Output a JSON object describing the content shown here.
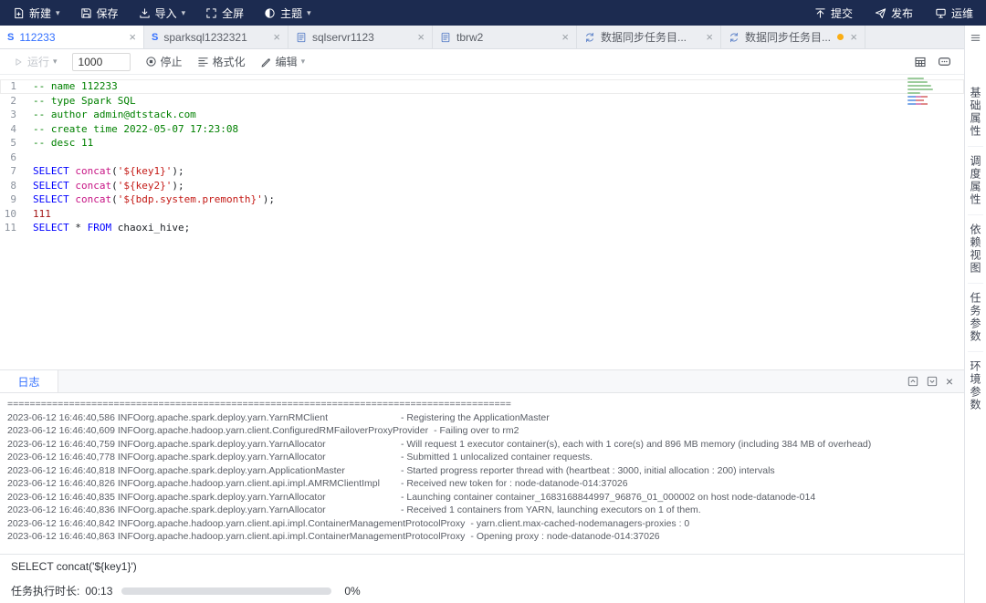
{
  "colors": {
    "topbar-bg": "#1c2b50",
    "accent": "#3370ff",
    "tok-comment": "#008000",
    "tok-keyword": "#0000ff",
    "tok-function": "#c71585",
    "tok-string": "#c41a16",
    "tok-number": "#a31515"
  },
  "topbar": {
    "left": [
      {
        "id": "new",
        "label": "新建",
        "icon": "new",
        "dropdown": true
      },
      {
        "id": "save",
        "label": "保存",
        "icon": "save",
        "dropdown": false
      },
      {
        "id": "import",
        "label": "导入",
        "icon": "import",
        "dropdown": true
      },
      {
        "id": "fullscreen",
        "label": "全屏",
        "icon": "fullscreen",
        "dropdown": false
      },
      {
        "id": "theme",
        "label": "主题",
        "icon": "theme",
        "dropdown": true
      }
    ],
    "right": [
      {
        "id": "submit",
        "label": "提交",
        "icon": "submit",
        "dropdown": false
      },
      {
        "id": "publish",
        "label": "发布",
        "icon": "publish",
        "dropdown": false
      },
      {
        "id": "ops",
        "label": "运维",
        "icon": "ops",
        "dropdown": false
      }
    ]
  },
  "tabs": [
    {
      "label": "112233",
      "icon": "spark",
      "active": true,
      "modified": false
    },
    {
      "label": "sparksql1232321",
      "icon": "spark",
      "active": false,
      "modified": false
    },
    {
      "label": "sqlservr1123",
      "icon": "file",
      "active": false,
      "modified": false
    },
    {
      "label": "tbrw2",
      "icon": "file",
      "active": false,
      "modified": false
    },
    {
      "label": "数据同步任务目...",
      "icon": "sync",
      "active": false,
      "modified": false
    },
    {
      "label": "数据同步任务目...",
      "icon": "sync",
      "active": false,
      "modified": true
    }
  ],
  "editor_toolbar": {
    "run_label": "运行",
    "limit_value": "1000",
    "stop_label": "停止",
    "format_label": "格式化",
    "edit_label": "编辑"
  },
  "editor": {
    "lines": [
      {
        "n": "1",
        "current": true,
        "tokens": [
          [
            "c",
            "-- name 112233"
          ]
        ]
      },
      {
        "n": "2",
        "tokens": [
          [
            "c",
            "-- type Spark SQL"
          ]
        ]
      },
      {
        "n": "3",
        "tokens": [
          [
            "c",
            "-- author admin@dtstack.com"
          ]
        ]
      },
      {
        "n": "4",
        "tokens": [
          [
            "c",
            "-- create time 2022-05-07 17:23:08"
          ]
        ]
      },
      {
        "n": "5",
        "tokens": [
          [
            "c",
            "-- desc 11"
          ]
        ]
      },
      {
        "n": "6",
        "tokens": []
      },
      {
        "n": "7",
        "tokens": [
          [
            "k",
            "SELECT"
          ],
          [
            "p",
            " "
          ],
          [
            "f",
            "concat"
          ],
          [
            "p",
            "("
          ],
          [
            "s",
            "'${key1}'"
          ],
          [
            "p",
            ");"
          ]
        ]
      },
      {
        "n": "8",
        "tokens": [
          [
            "k",
            "SELECT"
          ],
          [
            "p",
            " "
          ],
          [
            "f",
            "concat"
          ],
          [
            "p",
            "("
          ],
          [
            "s",
            "'${key2}'"
          ],
          [
            "p",
            ");"
          ]
        ]
      },
      {
        "n": "9",
        "tokens": [
          [
            "k",
            "SELECT"
          ],
          [
            "p",
            " "
          ],
          [
            "f",
            "concat"
          ],
          [
            "p",
            "("
          ],
          [
            "s",
            "'${bdp.system.premonth}'"
          ],
          [
            "p",
            ");"
          ]
        ]
      },
      {
        "n": "10",
        "tokens": [
          [
            "num",
            "111"
          ]
        ]
      },
      {
        "n": "11",
        "tokens": [
          [
            "k",
            "SELECT"
          ],
          [
            "p",
            " * "
          ],
          [
            "k",
            "FROM"
          ],
          [
            "p",
            " chaoxi_hive;"
          ]
        ]
      }
    ]
  },
  "right_sidebar": {
    "items": [
      {
        "id": "basic-props",
        "label": "基础属性"
      },
      {
        "id": "schedule-props",
        "label": "调度属性"
      },
      {
        "id": "dependency-view",
        "label": "依赖视图"
      },
      {
        "id": "task-params",
        "label": "任务参数"
      },
      {
        "id": "env-params",
        "label": "环境参数"
      }
    ]
  },
  "log": {
    "tab_label": "日志",
    "lines": [
      {
        "full": "=========================================================================================="
      },
      {
        "ts": "2023-06-12 16:46:40,586 INFO",
        "cls": "org.apache.spark.deploy.yarn.YarnRMClient",
        "msg": "- Registering the ApplicationMaster"
      },
      {
        "ts": "2023-06-12 16:46:40,609 INFO",
        "cls": "org.apache.hadoop.yarn.client.ConfiguredRMFailoverProxyProvider",
        "msg": "- Failing over to rm2"
      },
      {
        "ts": "2023-06-12 16:46:40,759 INFO",
        "cls": "org.apache.spark.deploy.yarn.YarnAllocator",
        "msg": "- Will request 1 executor container(s), each with 1 core(s) and 896 MB memory (including 384 MB of overhead)"
      },
      {
        "ts": "2023-06-12 16:46:40,778 INFO",
        "cls": "org.apache.spark.deploy.yarn.YarnAllocator",
        "msg": "- Submitted 1 unlocalized container requests."
      },
      {
        "ts": "2023-06-12 16:46:40,818 INFO",
        "cls": "org.apache.spark.deploy.yarn.ApplicationMaster",
        "msg": "- Started progress reporter thread with (heartbeat : 3000, initial allocation : 200) intervals"
      },
      {
        "ts": "2023-06-12 16:46:40,826 INFO",
        "cls": "org.apache.hadoop.yarn.client.api.impl.AMRMClientImpl",
        "msg": "- Received new token for : node-datanode-014:37026"
      },
      {
        "ts": "2023-06-12 16:46:40,835 INFO",
        "cls": "org.apache.spark.deploy.yarn.YarnAllocator",
        "msg": "- Launching container container_1683168844997_96876_01_000002 on host node-datanode-014"
      },
      {
        "ts": "2023-06-12 16:46:40,836 INFO",
        "cls": "org.apache.spark.deploy.yarn.YarnAllocator",
        "msg": "- Received 1 containers from YARN, launching executors on 1 of them."
      },
      {
        "ts": "2023-06-12 16:46:40,842 INFO",
        "cls": "org.apache.hadoop.yarn.client.api.impl.ContainerManagementProtocolProxy",
        "msg": "- yarn.client.max-cached-nodemanagers-proxies : 0"
      },
      {
        "ts": "2023-06-12 16:46:40,863 INFO",
        "cls": "org.apache.hadoop.yarn.client.api.impl.ContainerManagementProtocolProxy",
        "msg": "- Opening proxy : node-datanode-014:37026"
      }
    ]
  },
  "result": {
    "sql": "SELECT concat('${key1}')"
  },
  "status": {
    "duration_label": "任务执行时长:",
    "duration": "00:13",
    "percent": "0%",
    "progress_value": 0
  }
}
